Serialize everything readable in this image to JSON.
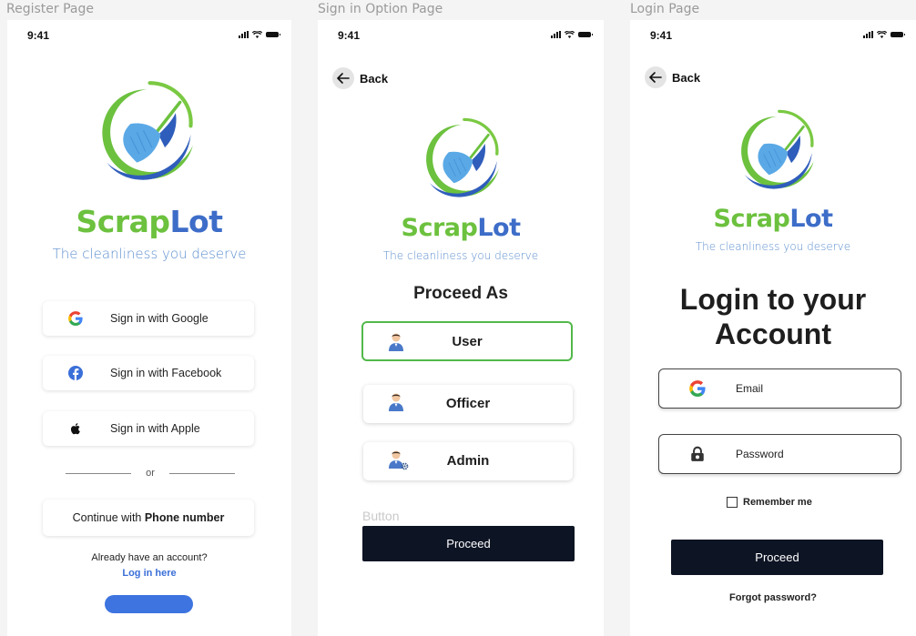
{
  "frames": {
    "register": "Register Page",
    "signin_option": "Sign in Option Page",
    "login": "Login Page"
  },
  "status": {
    "time": "9:41"
  },
  "brand": {
    "part1": "Scrap",
    "part2": "Lot",
    "tagline": "The cleanliness you deserve",
    "green": "#6cc13e",
    "blue": "#3d6dc8"
  },
  "register": {
    "google": "Sign in with Google",
    "facebook": "Sign in with Facebook",
    "apple": "Sign in with Apple",
    "or": "or",
    "phone_prefix": "Continue with ",
    "phone_bold": "Phone number",
    "have_account": "Already have an account?",
    "login_link": "Log in here"
  },
  "signin_option": {
    "back": "Back",
    "heading": "Proceed As",
    "roles": [
      "User",
      "Officer",
      "Admin"
    ],
    "button_caption": "Button",
    "proceed": "Proceed"
  },
  "login": {
    "back": "Back",
    "title_line1": "Login to your",
    "title_line2": "Account",
    "email": "Email",
    "password": "Password",
    "remember": "Remember me",
    "proceed": "Proceed",
    "forgot": "Forgot password?"
  }
}
